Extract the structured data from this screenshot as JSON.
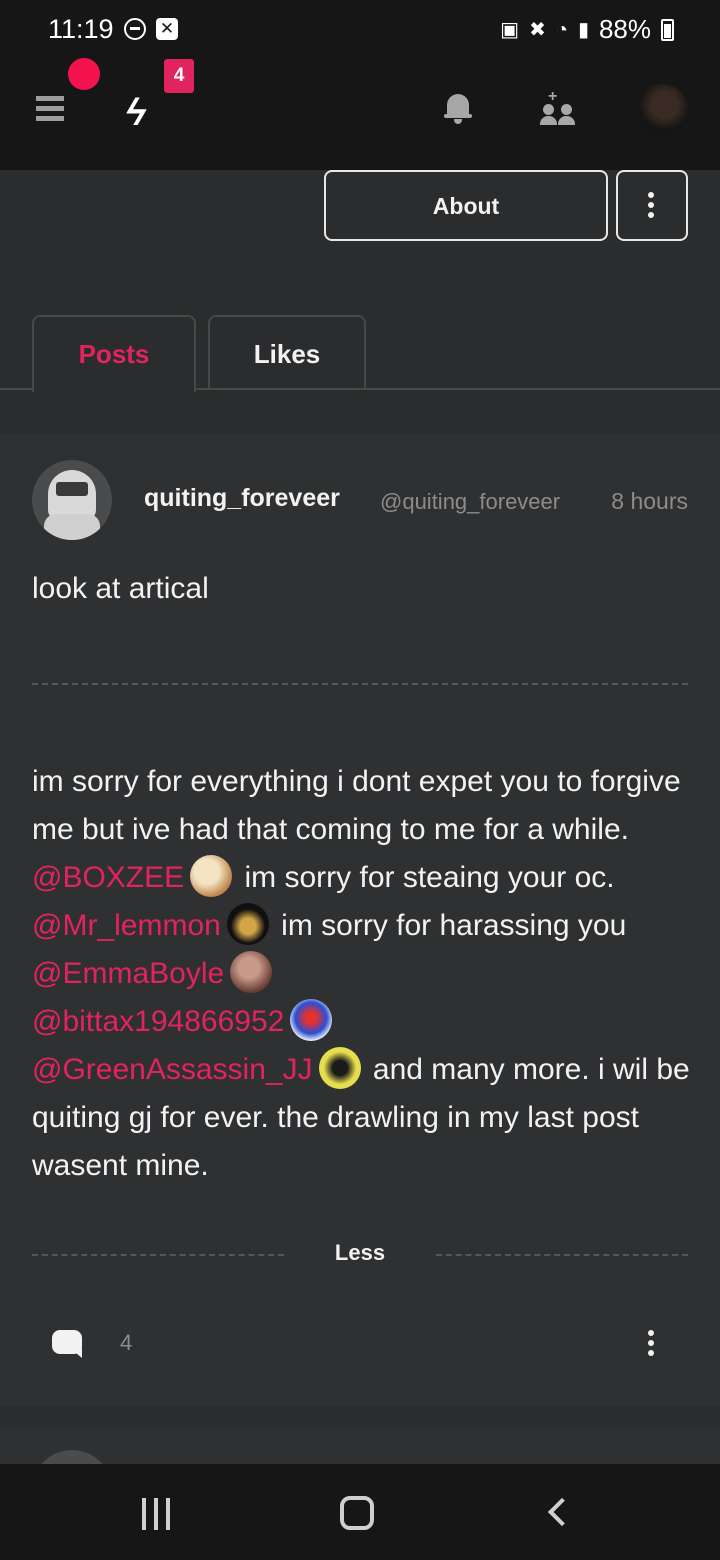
{
  "status_bar": {
    "time": "11:19",
    "battery": "88%"
  },
  "header": {
    "notification_badge": "4"
  },
  "profile": {
    "about_label": "About"
  },
  "tabs": [
    {
      "label": "Posts",
      "active": true
    },
    {
      "label": "Likes",
      "active": false
    }
  ],
  "post": {
    "username": "quiting_foreveer",
    "handle": "@quiting_foreveer",
    "time": "8 hours",
    "title": "look at artical",
    "body_parts": {
      "p1": "im sorry for everything i dont expet you to forgive me but ive had that coming to me for a while. ",
      "m1": "@BOXZEE",
      "p2": " im sorry for steaing your oc. ",
      "m2": "@Mr_lemmon",
      "p3": " im sorry for harassing you ",
      "m3": "@EmmaBoyle",
      "m4": "@bittax194866952",
      "m5": "@GreenAssassin_JJ",
      "p4": " and many more. i wil be quiting gj for ever. the drawling in my last post wasent mine."
    },
    "less_label": "Less",
    "comment_count": "4"
  },
  "colors": {
    "accent": "#e2245e",
    "background": "#2b2c2d",
    "card": "#2f3031",
    "bar": "#161616"
  }
}
